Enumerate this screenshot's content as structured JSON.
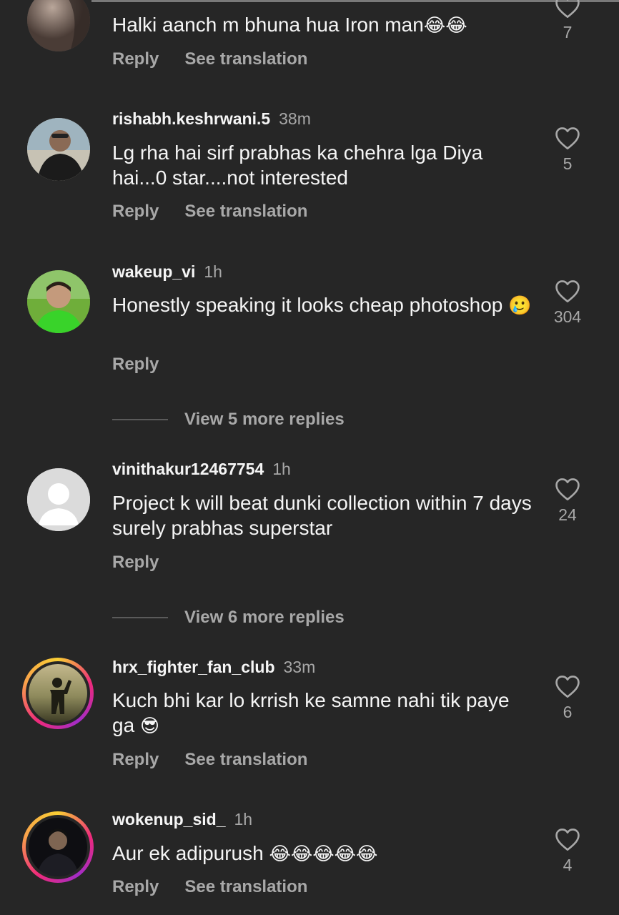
{
  "labels": {
    "reply": "Reply",
    "see_translation": "See translation"
  },
  "comments": [
    {
      "username": "",
      "time": "",
      "text": "Halki aanch m bhuna hua Iron man",
      "emoji": "😂😂",
      "likes": "7",
      "has_translation": true
    },
    {
      "username": "rishabh.keshrwani.5",
      "time": "38m",
      "text": "Lg rha hai sirf prabhas ka chehra lga Diya hai...0 star....not interested",
      "emoji": "",
      "likes": "5",
      "has_translation": true
    },
    {
      "username": "wakeup_vi",
      "time": "1h",
      "text": "Honestly speaking it looks cheap photoshop",
      "emoji": "🥲",
      "likes": "304",
      "has_translation": false,
      "view_more": "View 5 more replies"
    },
    {
      "username": "vinithakur12467754",
      "time": "1h",
      "text": "Project k will beat dunki collection within 7 days surely prabhas superstar",
      "emoji": "",
      "likes": "24",
      "has_translation": false,
      "view_more": "View 6 more replies"
    },
    {
      "username": "hrx_fighter_fan_club",
      "time": "33m",
      "text": "Kuch bhi kar lo krrish ke samne nahi tik paye ga",
      "emoji": "😎",
      "likes": "6",
      "has_translation": true
    },
    {
      "username": "wokenup_sid_",
      "time": "1h",
      "text": "Aur ek adipurush",
      "emoji": "😂😂😂😂😂",
      "likes": "4",
      "has_translation": true
    }
  ],
  "icons": {
    "like": "heart-outline-icon"
  },
  "colors": {
    "background": "#262626",
    "muted": "#a8a8a8",
    "text": "#f5f5f5"
  }
}
